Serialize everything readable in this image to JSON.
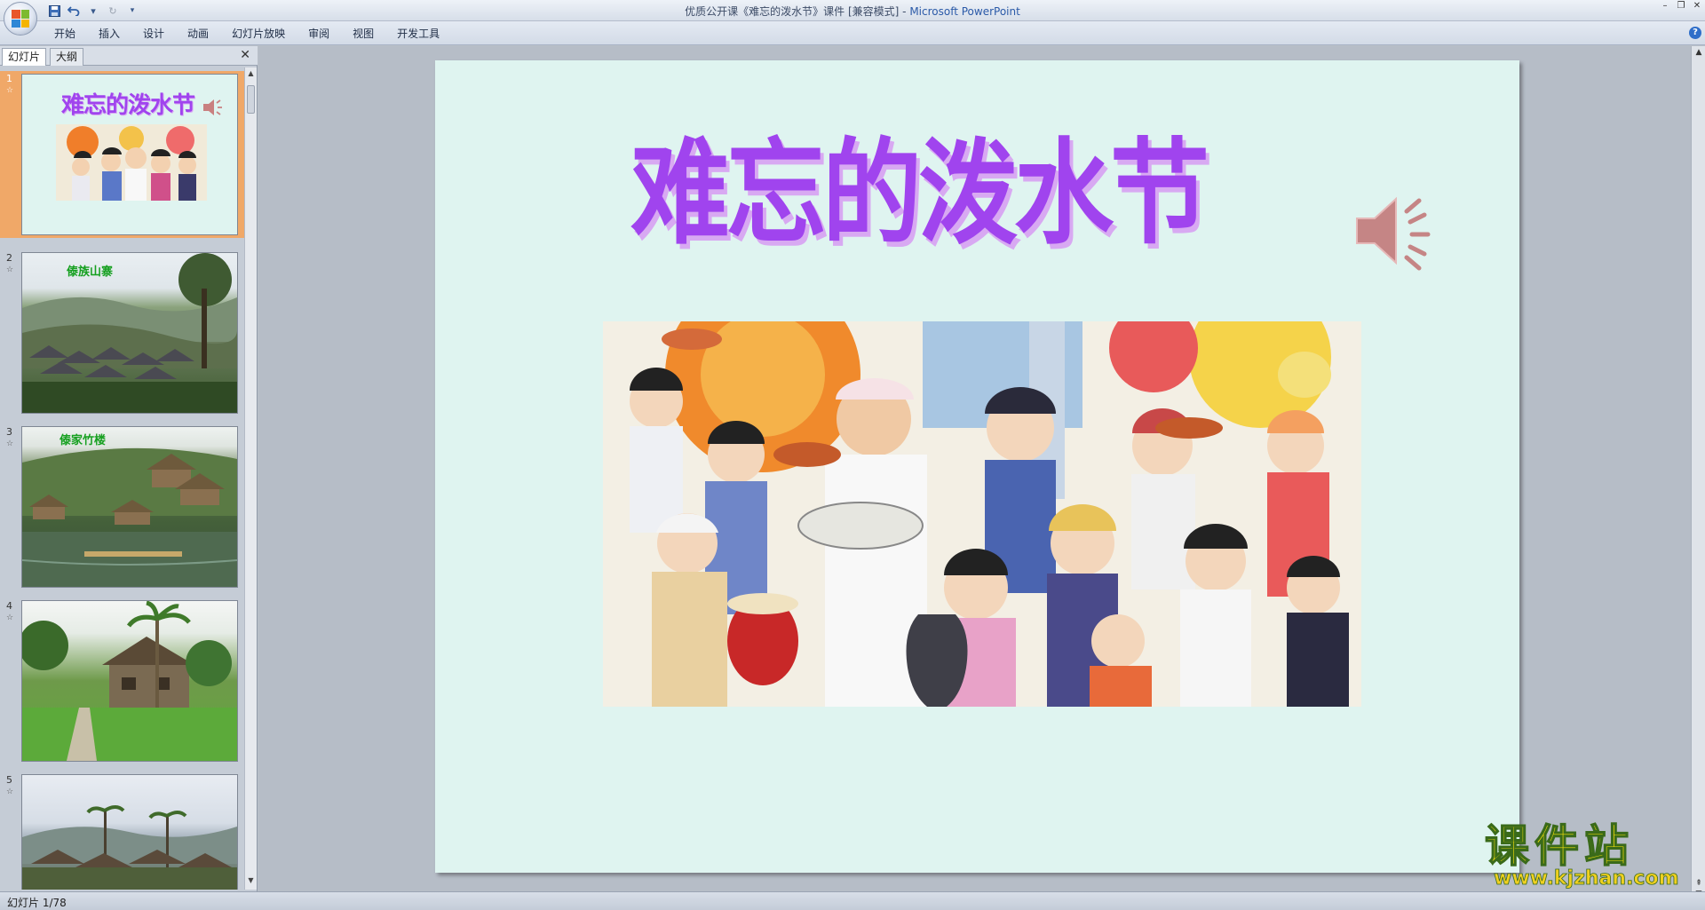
{
  "window": {
    "title": "优质公开课《难忘的泼水节》课件 [兼容模式] - ",
    "app_name": "Microsoft PowerPoint"
  },
  "ribbon": {
    "tabs": [
      "开始",
      "插入",
      "设计",
      "动画",
      "幻灯片放映",
      "审阅",
      "视图",
      "开发工具"
    ]
  },
  "left_panel": {
    "tabs": [
      "幻灯片",
      "大纲"
    ],
    "thumbnails": [
      {
        "number": "1",
        "title": "难忘的泼水节",
        "selected": true
      },
      {
        "number": "2",
        "title": "傣族山寨"
      },
      {
        "number": "3",
        "title": "傣家竹楼"
      },
      {
        "number": "4",
        "title": ""
      },
      {
        "number": "5",
        "title": ""
      }
    ]
  },
  "slide": {
    "title": "难忘的泼水节"
  },
  "status": {
    "slide_counter": "幻灯片 1/78"
  },
  "watermark": {
    "line1": "课件站",
    "line2": "www.kjzhan.com"
  },
  "colors": {
    "slide_bg": "#dff4f0",
    "title_purple": "#a044ee",
    "thumb_title_green": "#16a020",
    "selected_thumb": "#f0a868",
    "watermark_yellow": "#f5e10a"
  }
}
